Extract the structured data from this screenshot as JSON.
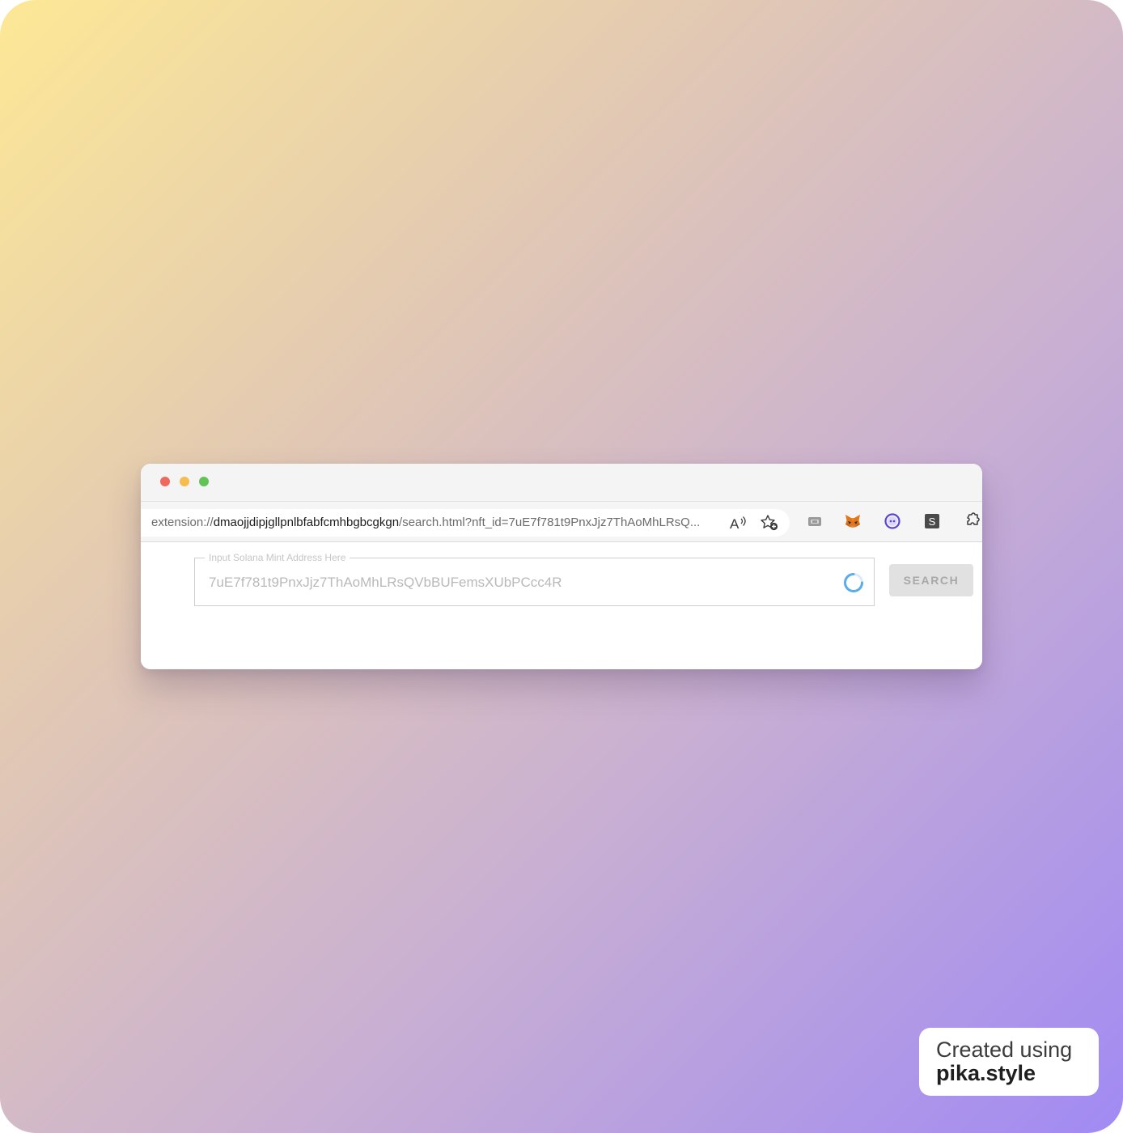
{
  "browser": {
    "url_scheme": "extension://",
    "url_host": "dmaojjdipjgllpnlbfabfcmhbgbcgkgn",
    "url_rest": "/search.html?nft_id=7uE7f781t9PnxJjz7ThAoMhLRsQ...",
    "toolbar_icons": [
      "read-aloud-icon",
      "favorite-add-icon"
    ],
    "extension_icons": [
      "extension-keyboard-icon",
      "metamask-fox-icon",
      "circle-extension-icon",
      "s-extension-icon",
      "extensions-puzzle-icon"
    ],
    "s_extension_letter": "S"
  },
  "search": {
    "legend": "Input Solana Mint Address Here",
    "value": "7uE7f781t9PnxJjz7ThAoMhLRsQVbBUFemsXUbPCcc4R",
    "button_label": "SEARCH",
    "loading": true
  },
  "badge": {
    "line1": "Created using",
    "line2": "pika.style"
  },
  "colors": {
    "traffic_red": "#ee6a5f",
    "traffic_yellow": "#f5bd4f",
    "traffic_green": "#61c454",
    "spinner_blue": "#5aaee8",
    "metamask_orange": "#e2761b",
    "circle_purple": "#5b43d6"
  }
}
